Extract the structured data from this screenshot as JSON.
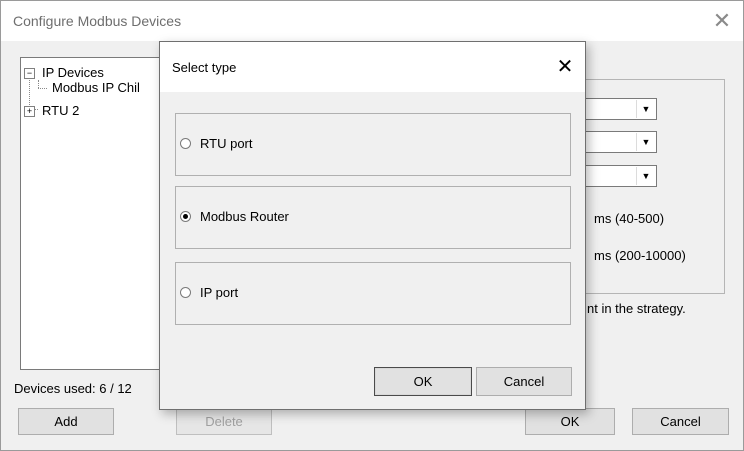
{
  "outer_window": {
    "title": "Configure Modbus Devices",
    "close_glyph": "✕",
    "tree": {
      "items": [
        {
          "label": "IP Devices",
          "expander": "⊟"
        },
        {
          "label": "Modbus IP Chil"
        },
        {
          "label": "RTU 2",
          "expander": "⊞"
        }
      ]
    },
    "settings": {
      "dropdown_glyph": "▼",
      "timeout_range": "ms (40-500)",
      "interval_range": "ms (200-10000)",
      "strategy_note": "nt in the strategy."
    },
    "devices_used": "Devices used: 6 / 12",
    "buttons": {
      "add": "Add",
      "delete": "Delete",
      "ok": "OK",
      "cancel": "Cancel"
    }
  },
  "dialog": {
    "title": "Select type",
    "close_glyph": "✕",
    "options": [
      {
        "label": "RTU port",
        "selected": false
      },
      {
        "label": "Modbus Router",
        "selected": true
      },
      {
        "label": "IP port",
        "selected": false
      }
    ],
    "ok": "OK",
    "cancel": "Cancel"
  }
}
